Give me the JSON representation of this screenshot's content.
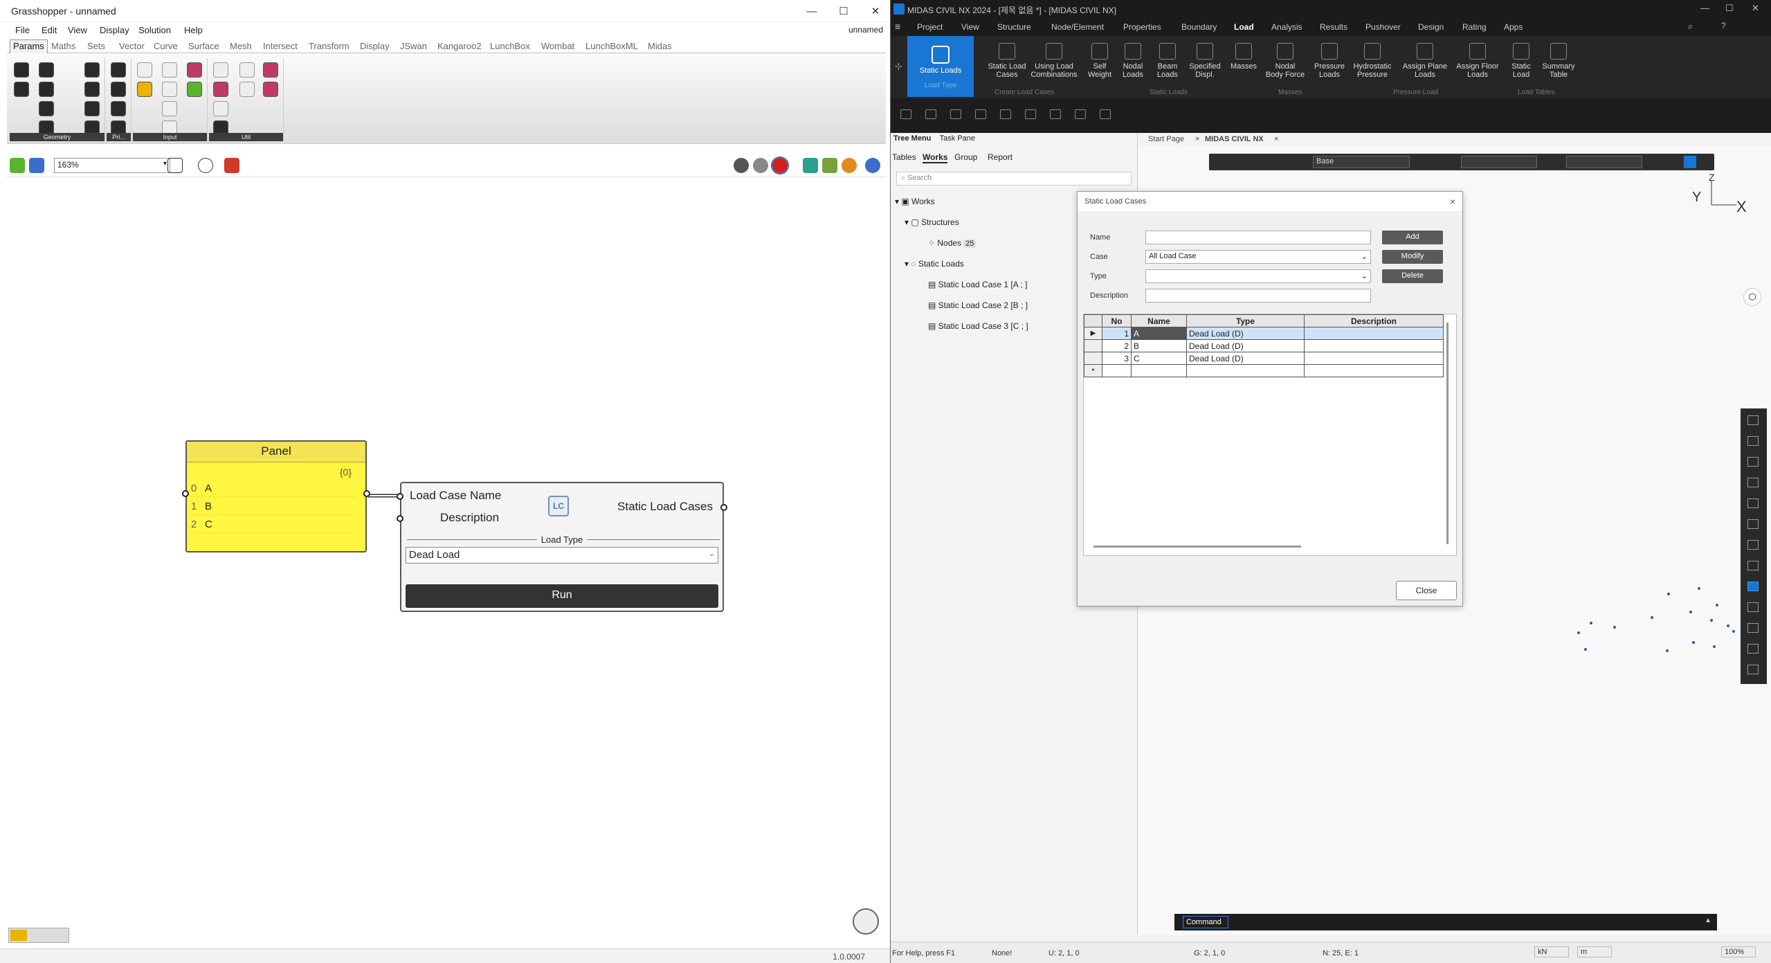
{
  "gh": {
    "title": "Grasshopper - unnamed",
    "doc_name": "unnamed",
    "menu": [
      "File",
      "Edit",
      "View",
      "Display",
      "Solution",
      "Help"
    ],
    "tabs": [
      "Params",
      "Maths",
      "Sets",
      "Vector",
      "Curve",
      "Surface",
      "Mesh",
      "Intersect",
      "Transform",
      "Display",
      "JSwan",
      "Kangaroo2",
      "LunchBox",
      "Wombat",
      "LunchBoxML",
      "Midas"
    ],
    "groups": {
      "geometry": "Geometry",
      "pr": "Pri...",
      "input": "Input",
      "util": "Util"
    },
    "zoom": "163%",
    "panel": {
      "title": "Panel",
      "path": "{0}",
      "rows": [
        {
          "i": "0",
          "v": "A"
        },
        {
          "i": "1",
          "v": "B"
        },
        {
          "i": "2",
          "v": "C"
        }
      ]
    },
    "component": {
      "in1": "Load Case Name",
      "in2": "Description",
      "icon": "LC",
      "out": "Static Load Cases",
      "load_type_label": "Load Type",
      "load_type_value": "Dead Load",
      "run": "Run"
    },
    "version": "1.0.0007"
  },
  "md": {
    "title": "MIDAS CIVIL NX 2024 - [제목 없음 *] - [MIDAS CIVIL NX]",
    "menu": [
      "Project",
      "View",
      "Structure",
      "Node/Element",
      "Properties",
      "Boundary",
      "Load",
      "Analysis",
      "Results",
      "Pushover",
      "Design",
      "Rating",
      "Apps"
    ],
    "ribbon": {
      "static_loads": "Static Loads",
      "load_type": "Load Type",
      "buttons": [
        {
          "label": "Static Load\nCases"
        },
        {
          "label": "Using Load\nCombinations"
        },
        {
          "label": "Self\nWeight"
        },
        {
          "label": "Nodal\nLoads"
        },
        {
          "label": "Beam\nLoads"
        },
        {
          "label": "Specified\nDispl."
        },
        {
          "label": "Masses"
        },
        {
          "label": "Nodal\nBody Force"
        },
        {
          "label": "Pressure\nLoads"
        },
        {
          "label": "Hydrostatic\nPressure"
        },
        {
          "label": "Assign Plane\nLoads"
        },
        {
          "label": "Assign Floor\nLoads"
        },
        {
          "label": "Static\nLoad"
        },
        {
          "label": "Summary\nTable"
        }
      ],
      "groups": [
        "Create Load Cases",
        "Static Loads",
        "Masses",
        "Pressure Load",
        "Load Tables"
      ]
    },
    "tree": {
      "header": "Tree Menu",
      "task_pane": "Task Pane",
      "tabs": [
        "Tables",
        "Works",
        "Group",
        "Report"
      ],
      "search": "Search",
      "works": "Works",
      "structures": "Structures",
      "nodes": "Nodes",
      "nodes_count": "25",
      "static_loads": "Static Loads",
      "cases": [
        "Static Load Case 1 [A ; ]",
        "Static Load Case 2 [B ; ]",
        "Static Load Case 3 [C ; ]"
      ]
    },
    "doc_tabs": [
      "Start Page",
      "MIDAS CIVIL NX"
    ],
    "view": {
      "base": "Base",
      "axis_y": "Y",
      "axis_z": "Z",
      "axis_x": "X"
    },
    "command": "Command",
    "status": {
      "help": "For Help, press F1",
      "none": "None!",
      "u": "U: 2, 1, 0",
      "g": "G: 2, 1, 0",
      "n": "N: 25, E: 1",
      "unit_force": "kN",
      "unit_len": "m",
      "zoom": "100%"
    },
    "dialog": {
      "title": "Static Load Cases",
      "name_label": "Name",
      "case_label": "Case",
      "type_label": "Type",
      "desc_label": "Description",
      "case_value": "All Load Case",
      "add": "Add",
      "modify": "Modify",
      "delete": "Delete",
      "headers": [
        "No",
        "Name",
        "Type",
        "Description"
      ],
      "rows": [
        {
          "no": "1",
          "name": "A",
          "type": "Dead Load (D)"
        },
        {
          "no": "2",
          "name": "B",
          "type": "Dead Load (D)"
        },
        {
          "no": "3",
          "name": "C",
          "type": "Dead Load (D)"
        }
      ],
      "new_row_marker": "*",
      "close": "Close"
    }
  }
}
